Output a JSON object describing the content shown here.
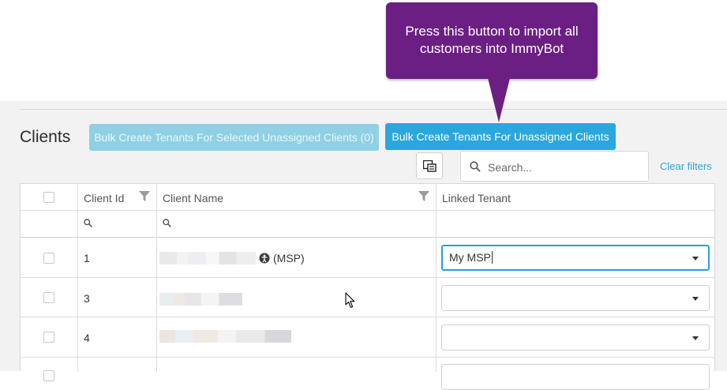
{
  "callout": {
    "text_line1": "Press this button to import all",
    "text_line2": "customers into ImmyBot",
    "color": "#6b1f83"
  },
  "page": {
    "title": "Clients"
  },
  "toolbar": {
    "bulk_selected_label": "Bulk Create Tenants For Selected Unassigned Clients (0)",
    "bulk_all_label": "Bulk Create Tenants For Unassigned Clients",
    "search_placeholder": "Search...",
    "clear_filters_label": "Clear filters",
    "primary_color": "#2aa7dc"
  },
  "table": {
    "columns": [
      "Client Id",
      "Client Name",
      "Linked Tenant"
    ],
    "rows": [
      {
        "client_id": "1",
        "client_name_suffix": "(MSP)",
        "linked_tenant": "My MSP"
      },
      {
        "client_id": "3",
        "client_name_suffix": "",
        "linked_tenant": ""
      },
      {
        "client_id": "4",
        "client_name_suffix": "",
        "linked_tenant": ""
      }
    ]
  }
}
